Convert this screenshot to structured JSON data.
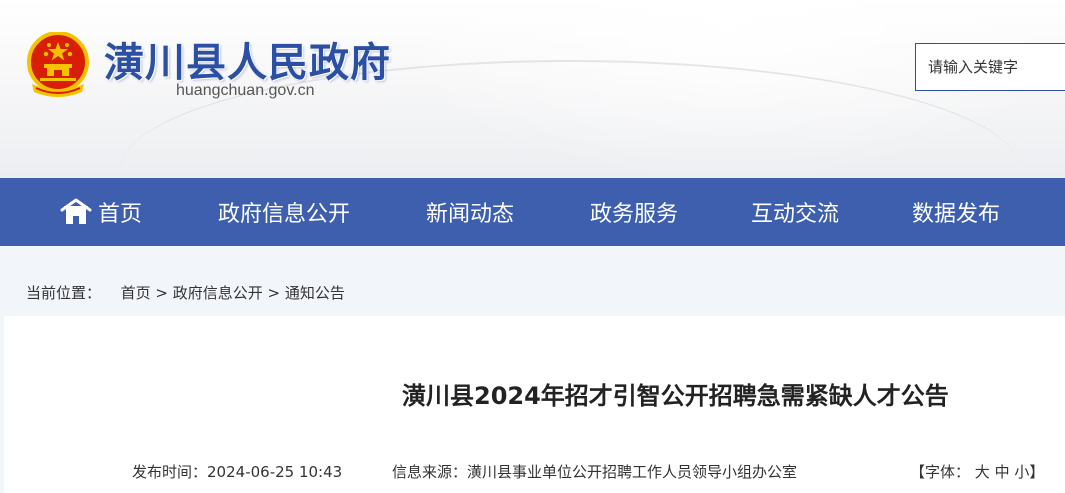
{
  "header": {
    "site_title": "潢川县人民政府",
    "site_domain": "huangchuan.gov.cn",
    "emblem_icon": "national-emblem-icon",
    "search_placeholder": "请输入关键字"
  },
  "nav": {
    "items": [
      {
        "label": "首页",
        "icon": "home-icon"
      },
      {
        "label": "政府信息公开"
      },
      {
        "label": "新闻动态"
      },
      {
        "label": "政务服务"
      },
      {
        "label": "互动交流"
      },
      {
        "label": "数据发布"
      }
    ]
  },
  "breadcrumb": {
    "prefix": "当前位置：",
    "items": [
      "首页",
      "政府信息公开",
      "通知公告"
    ],
    "separator": ">"
  },
  "article": {
    "title": "潢川县2024年招才引智公开招聘急需紧缺人才公告",
    "publish_label": "发布时间：",
    "publish_time": "2024-06-25 10:43",
    "source_label": "信息来源：",
    "source": "潢川县事业单位公开招聘工作人员领导小组办公室",
    "font_label": "【字体：",
    "font_sizes": [
      "大",
      "中",
      "小"
    ],
    "font_close": "】"
  },
  "colors": {
    "brand_blue": "#2a4fa3",
    "nav_bg": "#3d5fad",
    "emblem_red": "#d81e06",
    "emblem_gold": "#f5c200"
  }
}
